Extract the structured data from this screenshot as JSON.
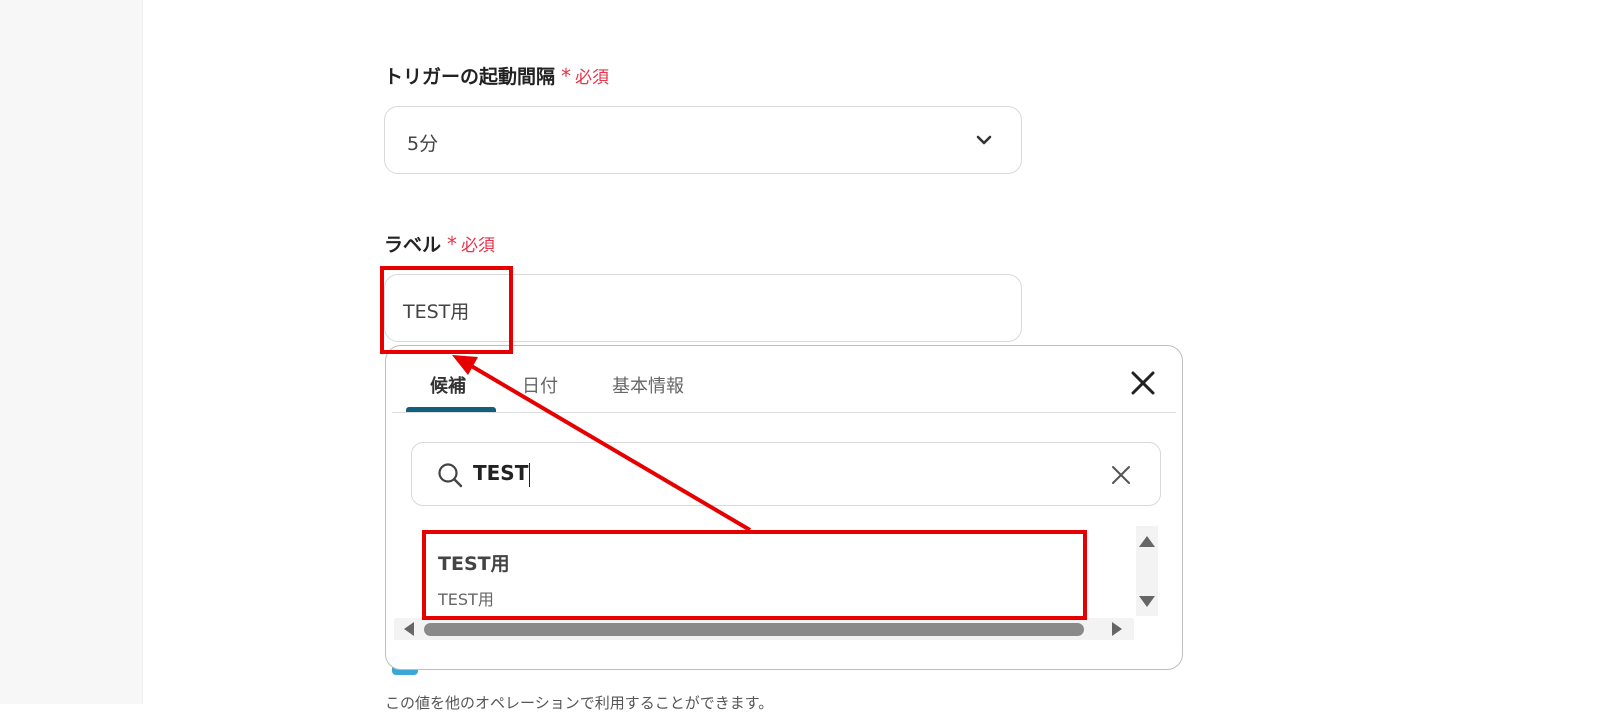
{
  "trigger_interval": {
    "label": "トリガーの起動間隔",
    "required_mark": "*",
    "required_text": "必須",
    "selected_value": "5分"
  },
  "label_field": {
    "label": "ラベル",
    "required_mark": "*",
    "required_text": "必須",
    "value": "TEST用"
  },
  "popup": {
    "tabs": [
      {
        "label": "候補",
        "active": true
      },
      {
        "label": "日付",
        "active": false
      },
      {
        "label": "基本情報",
        "active": false
      }
    ],
    "search": {
      "value": "TEST"
    },
    "results": [
      {
        "title": "TEST用",
        "subtitle": "TEST用"
      }
    ]
  },
  "footnote": "この値を他のオペレーションで利用することができます。",
  "colors": {
    "required": "#e8334a",
    "tab_underline": "#12607a",
    "annotation": "#e60000",
    "chip": "#3aa7d6"
  },
  "icons": [
    "chevron-down-icon",
    "close-icon",
    "search-icon",
    "clear-icon",
    "scroll-up-icon",
    "scroll-down-icon",
    "scroll-left-icon",
    "scroll-right-icon"
  ]
}
